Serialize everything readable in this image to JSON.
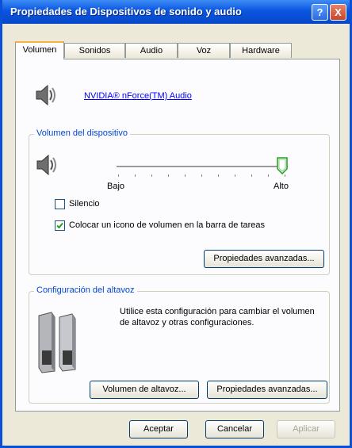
{
  "window": {
    "title": "Propiedades de Dispositivos de sonido y audio"
  },
  "titlebar_buttons": {
    "help": "?",
    "close": "X"
  },
  "tabs": [
    {
      "label": "Volumen",
      "active": true
    },
    {
      "label": "Sonidos",
      "active": false
    },
    {
      "label": "Audio",
      "active": false
    },
    {
      "label": "Voz",
      "active": false
    },
    {
      "label": "Hardware",
      "active": false
    }
  ],
  "device": {
    "name": "NVIDIA® nForce(TM) Audio",
    "icon": "speaker-icon"
  },
  "volume_group": {
    "label": "Volumen del dispositivo",
    "slider_low": "Bajo",
    "slider_high": "Alto",
    "slider_level": 1.0,
    "mute_label": "Silencio",
    "mute_checked": false,
    "tray_icon_label": "Colocar un icono de volumen en la barra de tareas",
    "tray_icon_checked": true,
    "advanced_button": "Propiedades avanzadas..."
  },
  "speaker_group": {
    "label": "Configuración del altavoz",
    "description": "Utilice esta configuración para cambiar el volumen de altavoz y otras configuraciones.",
    "volume_button": "Volumen de altavoz...",
    "advanced_button": "Propiedades avanzadas..."
  },
  "footer": {
    "ok": "Aceptar",
    "cancel": "Cancelar",
    "apply": "Aplicar"
  },
  "colors": {
    "title_bar": "#0a55e0",
    "group_label": "#0046d5",
    "link": "#0000ff"
  }
}
